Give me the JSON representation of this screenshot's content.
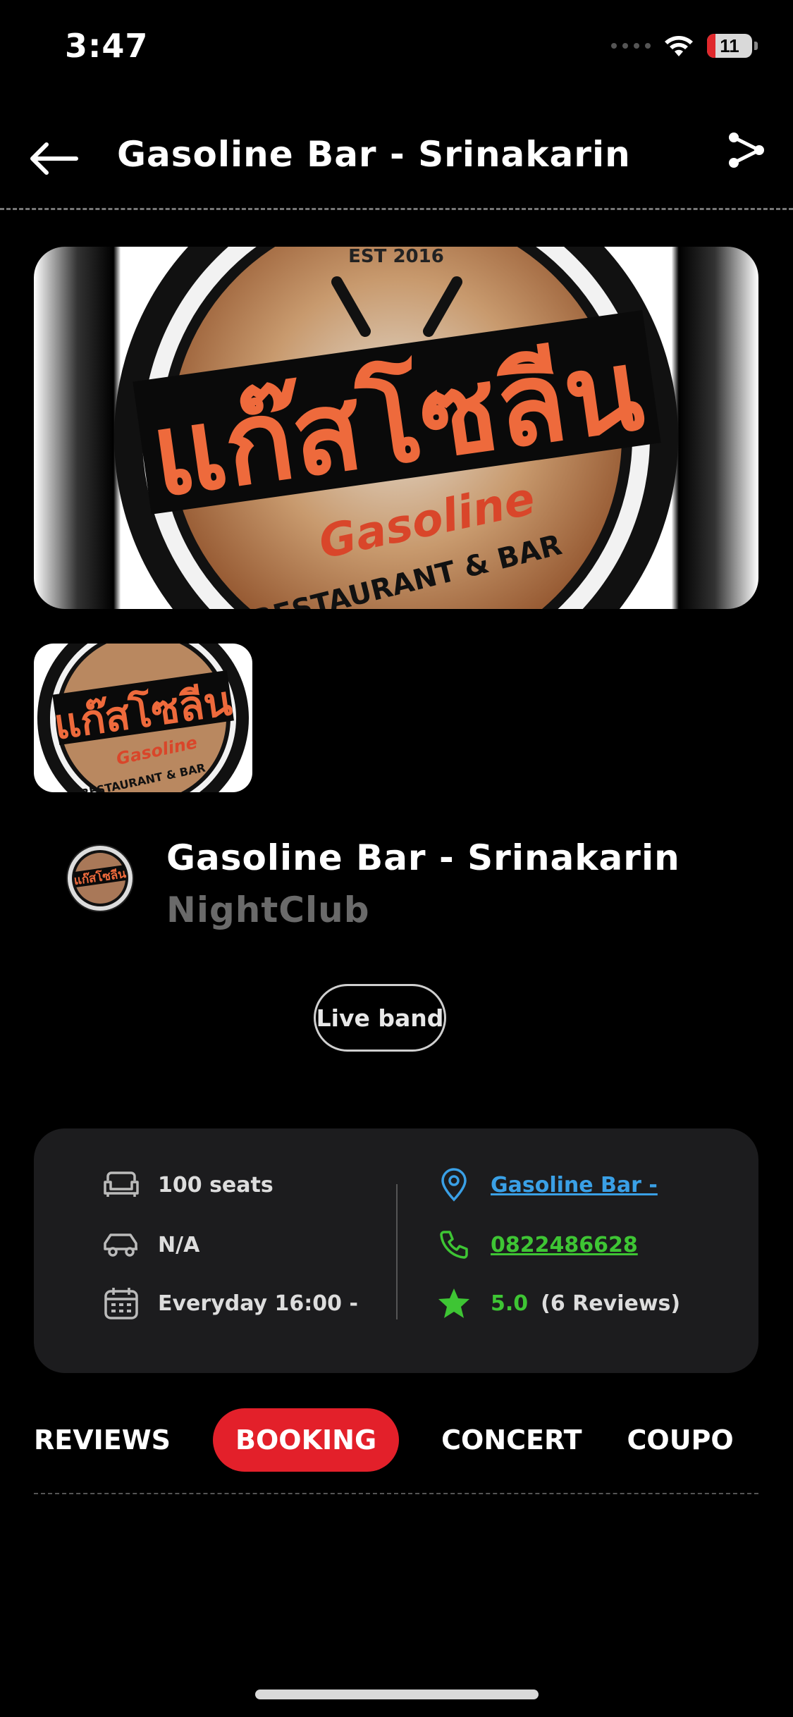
{
  "status_bar": {
    "time": "3:47",
    "battery": "11"
  },
  "header": {
    "title": "Gasoline Bar - Srinakarin"
  },
  "logo_text": {
    "thai": "แก๊สโซลีน",
    "script": "Gasoline",
    "est": "EST 2016",
    "tagline": "RESTAURANT & BAR"
  },
  "venue": {
    "name": "Gasoline Bar - Srinakarin",
    "type": "NightClub"
  },
  "tag": "Live band",
  "info": {
    "seats": "100 seats",
    "parking": "N/A",
    "hours": "Everyday 16:00 -",
    "address": "Gasoline Bar -",
    "phone": "0822486628",
    "rating": "5.0",
    "reviews": "(6 Reviews)"
  },
  "tabs": [
    "REVIEWS",
    "BOOKING",
    "CONCERT",
    "COUPO"
  ],
  "active_tab": "BOOKING",
  "colors": {
    "accent": "#e3202a",
    "link_blue": "#3aa0e6",
    "green": "#3ec534",
    "card": "#1c1c1e"
  }
}
